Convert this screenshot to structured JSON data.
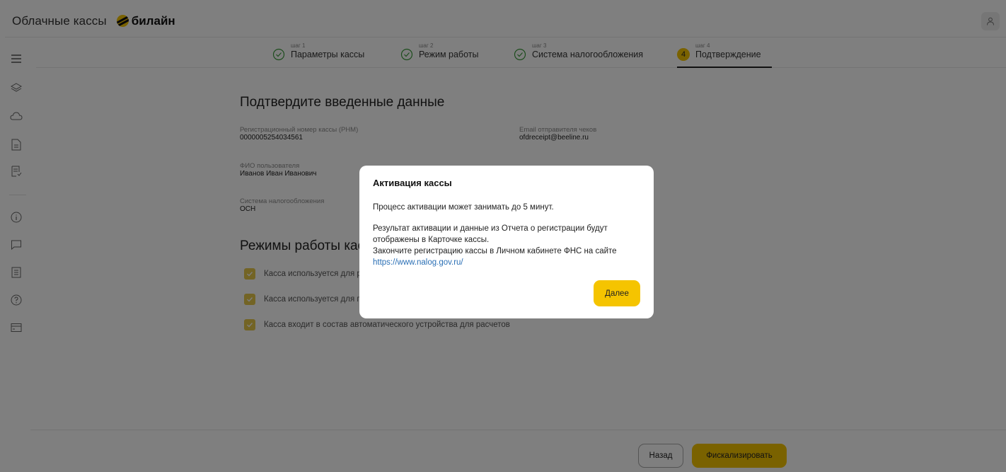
{
  "header": {
    "app_title": "Облачные кассы",
    "brand": "билайн"
  },
  "sidebar": {
    "items": [
      "menu-icon",
      "layers-icon",
      "cloud-icon",
      "document-icon",
      "receipt-list-icon",
      "info-icon",
      "chat-icon",
      "report-icon",
      "help-icon",
      "card-icon"
    ]
  },
  "stepper": {
    "steps": [
      {
        "small": "шаг 1",
        "label": "Параметры кассы",
        "status": "done"
      },
      {
        "small": "шаг 2",
        "label": "Режим работы",
        "status": "done"
      },
      {
        "small": "шаг 3",
        "label": "Система налогообложения",
        "status": "done"
      },
      {
        "small": "шаг 4",
        "label": "Подтверждение",
        "status": "active",
        "number": "4"
      }
    ]
  },
  "main": {
    "title": "Подтвердите введенные данные",
    "fields": [
      {
        "label": "Регистрационный номер кассы (РНМ)",
        "value": "0000005254034561"
      },
      {
        "label": "Email отправителя чеков",
        "value": "ofdreceipt@beeline.ru"
      },
      {
        "label": "ФИО пользователя",
        "value": "Иванов Иван Иванович"
      },
      {
        "label": "Система налогообложения",
        "value": "ОСН"
      }
    ],
    "modes_title": "Режимы работы кассы",
    "modes": [
      "Касса используется для р",
      "Касса используется для п",
      "Касса входит в состав автоматического устройства для расчетов"
    ]
  },
  "footer": {
    "back_label": "Назад",
    "fiscalize_label": "Фискализировать"
  },
  "modal": {
    "title": "Активация кассы",
    "text1": "Процесс активации может занимать до 5 минут.",
    "text2_line1": "Результат активации и данные из Отчета о регистрации будут",
    "text2_line2": "отображены в Карточке кассы.",
    "text2_line3": "Закончите регистрацию кассы в Личном кабинете ФНС на сайте",
    "link": "https://www.nalog.gov.ru/",
    "next_label": "Далее"
  },
  "colors": {
    "accent": "#f5c400",
    "link": "#2a6fb5",
    "check_green": "#3a9a3a"
  }
}
